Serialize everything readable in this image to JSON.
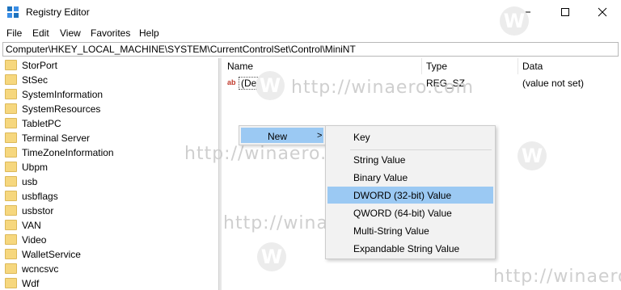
{
  "window": {
    "title": "Registry Editor",
    "icon": "registry-editor-icon"
  },
  "menu": [
    "File",
    "Edit",
    "View",
    "Favorites",
    "Help"
  ],
  "address": "Computer\\HKEY_LOCAL_MACHINE\\SYSTEM\\CurrentControlSet\\Control\\MiniNT",
  "tree": {
    "items": [
      "StorPort",
      "StSec",
      "SystemInformation",
      "SystemResources",
      "TabletPC",
      "Terminal Server",
      "TimeZoneInformation",
      "Ubpm",
      "usb",
      "usbflags",
      "usbstor",
      "VAN",
      "Video",
      "WalletService",
      "wcncsvc",
      "Wdf"
    ]
  },
  "list": {
    "headers": {
      "name": "Name",
      "type": "Type",
      "data": "Data"
    },
    "rows": [
      {
        "name": "(Default)",
        "type": "REG_SZ",
        "data": "(value not set)"
      }
    ]
  },
  "context_menu": {
    "new_label": "New",
    "arrow": ">"
  },
  "submenu": {
    "items": [
      "Key",
      "String Value",
      "Binary Value",
      "DWORD (32-bit) Value",
      "QWORD (64-bit) Value",
      "Multi-String Value",
      "Expandable String Value"
    ],
    "highlighted": "DWORD (32-bit) Value"
  },
  "watermark": {
    "text": "http://winaero.com",
    "letter": "W"
  },
  "colors": {
    "highlight": "#9bc9f3",
    "menu_bg": "#f2f2f2",
    "folder": "#f6d77e"
  }
}
